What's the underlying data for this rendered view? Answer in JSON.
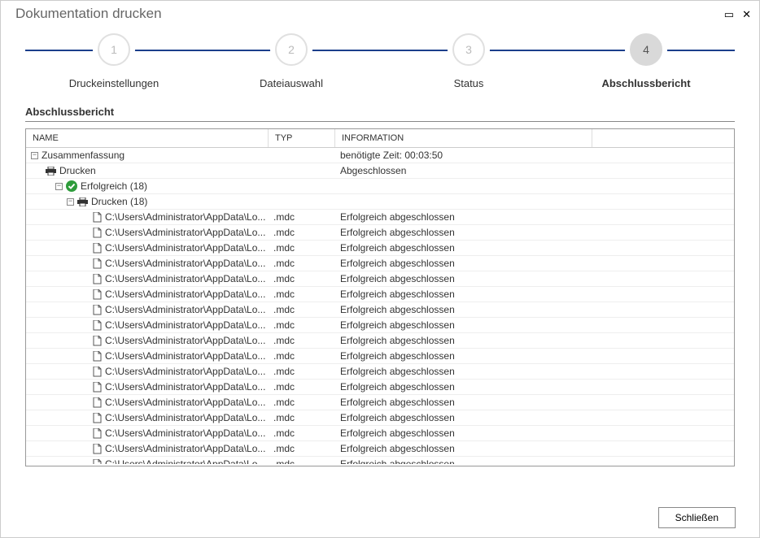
{
  "window": {
    "title": "Dokumentation drucken"
  },
  "stepper": {
    "steps": [
      {
        "num": "1",
        "label": "Druckeinstellungen"
      },
      {
        "num": "2",
        "label": "Dateiauswahl"
      },
      {
        "num": "3",
        "label": "Status"
      },
      {
        "num": "4",
        "label": "Abschlussbericht"
      }
    ],
    "active_index": 3
  },
  "section_title": "Abschlussbericht",
  "table": {
    "headers": {
      "name": "NAME",
      "typ": "TYP",
      "info": "INFORMATION"
    },
    "summary_row": {
      "name": "Zusammenfassung",
      "info": "benötigte Zeit: 00:03:50"
    },
    "print_row": {
      "name": "Drucken",
      "info": "Abgeschlossen"
    },
    "success_row": {
      "name": "Erfolgreich (18)"
    },
    "print_group": {
      "name": "Drucken (18)"
    },
    "file_name_truncated": "C:\\Users\\Administrator\\AppData\\Lo...",
    "file_typ": ".mdc",
    "file_info": "Erfolgreich abgeschlossen",
    "file_count": 17
  },
  "footer": {
    "close_label": "Schließen"
  }
}
